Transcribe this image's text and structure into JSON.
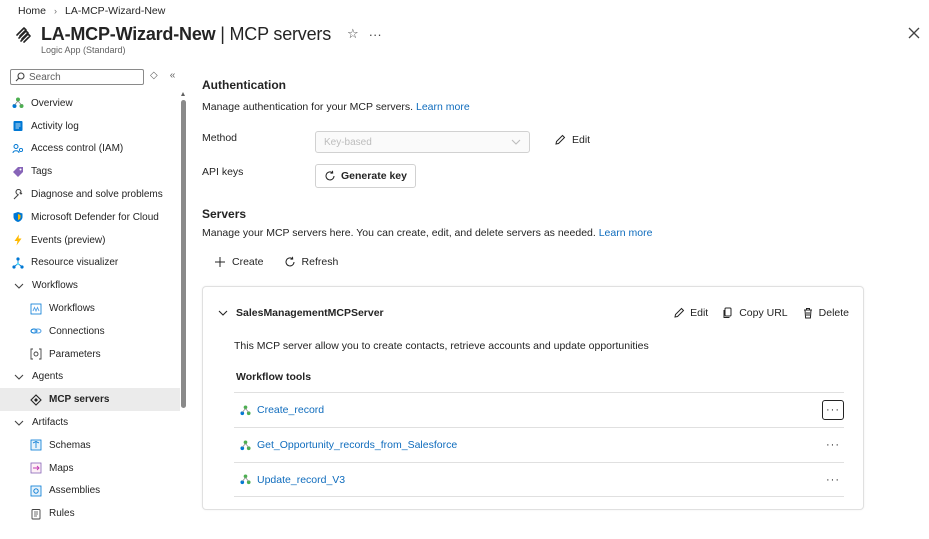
{
  "breadcrumb": {
    "home": "Home",
    "current": "LA-MCP-Wizard-New"
  },
  "header": {
    "title": "LA-MCP-Wizard-New",
    "separator": " | ",
    "page": "MCP servers",
    "subtitle": "Logic App (Standard)",
    "more": "···"
  },
  "sidebar": {
    "search_placeholder": "Search",
    "items": [
      {
        "label": "Overview",
        "icon": "overview-icon",
        "type": "top"
      },
      {
        "label": "Activity log",
        "icon": "activity-log-icon",
        "type": "top"
      },
      {
        "label": "Access control (IAM)",
        "icon": "iam-icon",
        "type": "top"
      },
      {
        "label": "Tags",
        "icon": "tag-icon",
        "type": "top"
      },
      {
        "label": "Diagnose and solve problems",
        "icon": "wrench-icon",
        "type": "top"
      },
      {
        "label": "Microsoft Defender for Cloud",
        "icon": "shield-icon",
        "type": "top"
      },
      {
        "label": "Events (preview)",
        "icon": "lightning-icon",
        "type": "top"
      },
      {
        "label": "Resource visualizer",
        "icon": "visualizer-icon",
        "type": "top"
      },
      {
        "label": "Workflows",
        "icon": "chevron-down-icon",
        "type": "group"
      },
      {
        "label": "Workflows",
        "icon": "workflow-icon",
        "type": "child"
      },
      {
        "label": "Connections",
        "icon": "connections-icon",
        "type": "child"
      },
      {
        "label": "Parameters",
        "icon": "parameters-icon",
        "type": "child"
      },
      {
        "label": "Agents",
        "icon": "chevron-down-icon",
        "type": "group"
      },
      {
        "label": "MCP servers",
        "icon": "mcp-icon",
        "type": "child",
        "active": true
      },
      {
        "label": "Artifacts",
        "icon": "chevron-down-icon",
        "type": "group"
      },
      {
        "label": "Schemas",
        "icon": "schemas-icon",
        "type": "child"
      },
      {
        "label": "Maps",
        "icon": "maps-icon",
        "type": "child"
      },
      {
        "label": "Assemblies",
        "icon": "assemblies-icon",
        "type": "child"
      },
      {
        "label": "Rules",
        "icon": "rules-icon",
        "type": "child"
      }
    ]
  },
  "auth": {
    "title": "Authentication",
    "desc": "Manage authentication for your MCP servers.",
    "learn_more": "Learn more",
    "method_label": "Method",
    "method_value": "Key-based",
    "edit_label": "Edit",
    "api_keys_label": "API keys",
    "generate_label": "Generate key"
  },
  "servers": {
    "title": "Servers",
    "desc": "Manage your MCP servers here. You can create, edit, and delete servers as needed.",
    "learn_more": "Learn more",
    "create_label": "Create",
    "refresh_label": "Refresh",
    "card": {
      "name": "SalesManagementMCPServer",
      "edit_label": "Edit",
      "copy_url_label": "Copy URL",
      "delete_label": "Delete",
      "description": "This MCP server allow you to create contacts, retrieve accounts and update opportunities",
      "tools_title": "Workflow tools",
      "tools": [
        {
          "name": "Create_record",
          "more": "···"
        },
        {
          "name": "Get_Opportunity_records_from_Salesforce",
          "more": "···"
        },
        {
          "name": "Update_record_V3",
          "more": "···"
        }
      ]
    }
  },
  "colors": {
    "link": "#0f6cbd",
    "text": "#242424",
    "active_bg": "#ebebeb"
  }
}
